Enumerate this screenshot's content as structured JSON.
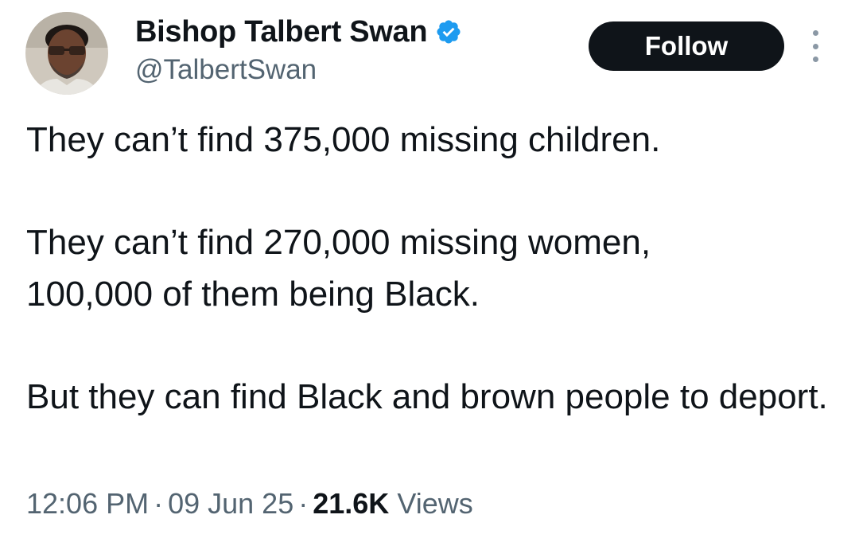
{
  "author": {
    "display_name": "Bishop Talbert Swan",
    "handle": "@TalbertSwan",
    "verified": true,
    "verified_color": "#1d9bf0"
  },
  "actions": {
    "follow_label": "Follow"
  },
  "tweet": {
    "paragraphs": [
      "They can’t find 375,000 missing children.",
      "They can’t find 270,000 missing women, 100,000 of them being Black.",
      "But they can find Black and brown people to deport."
    ]
  },
  "meta": {
    "time": "12:06 PM",
    "date": "09 Jun 25",
    "separator": "·",
    "views_count": "21.6K",
    "views_label": "Views"
  },
  "colors": {
    "text_primary": "#0f1419",
    "text_secondary": "#536471",
    "follow_bg": "#0f1419",
    "follow_text": "#ffffff"
  },
  "icons": {
    "verified": "verified-badge-icon",
    "more": "more-options-icon"
  }
}
